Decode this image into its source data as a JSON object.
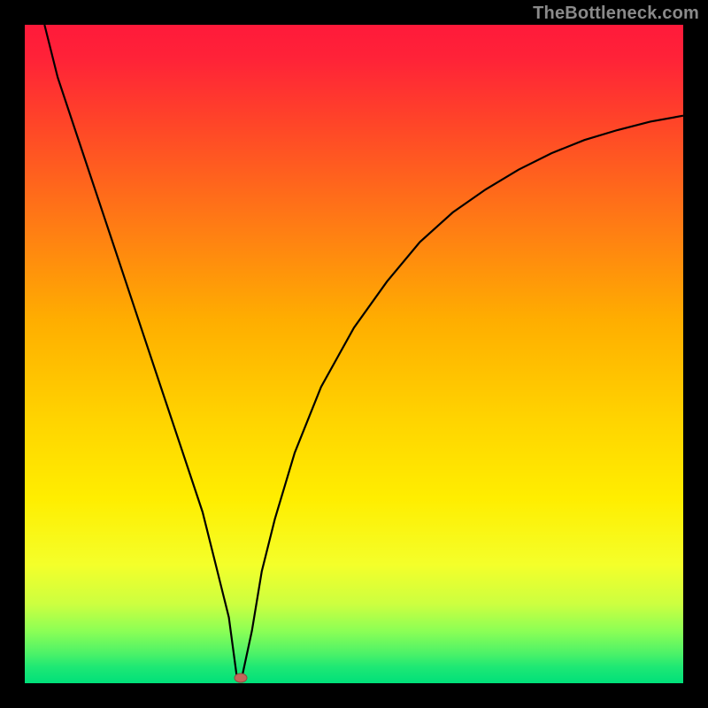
{
  "watermark": "TheBottleneck.com",
  "colors": {
    "black": "#000000",
    "red_top": "#ff1a3a",
    "yellow_mid": "#ffe600",
    "green_bottom": "#00e07a",
    "curve": "#000000",
    "marker_fill": "#c2665a",
    "marker_stroke": "#8f4a40"
  },
  "chart_data": {
    "type": "line",
    "title": "",
    "xlabel": "",
    "ylabel": "",
    "xlim": [
      0,
      100
    ],
    "ylim": [
      0,
      100
    ],
    "x": [
      3,
      5,
      8,
      12,
      15,
      18,
      21,
      24,
      27,
      29,
      31,
      32.2,
      33,
      34.5,
      36,
      38,
      41,
      45,
      50,
      55,
      60,
      65,
      70,
      75,
      80,
      85,
      90,
      95,
      100
    ],
    "values": [
      100,
      92,
      83,
      71,
      62,
      53,
      44,
      35,
      26,
      18,
      10,
      1,
      1,
      8,
      17,
      25,
      35,
      45,
      54,
      61,
      67,
      71.5,
      75,
      78,
      80.5,
      82.5,
      84,
      85.3,
      86.2
    ],
    "marker": {
      "x": 32.8,
      "y": 0.8
    },
    "annotations": []
  }
}
